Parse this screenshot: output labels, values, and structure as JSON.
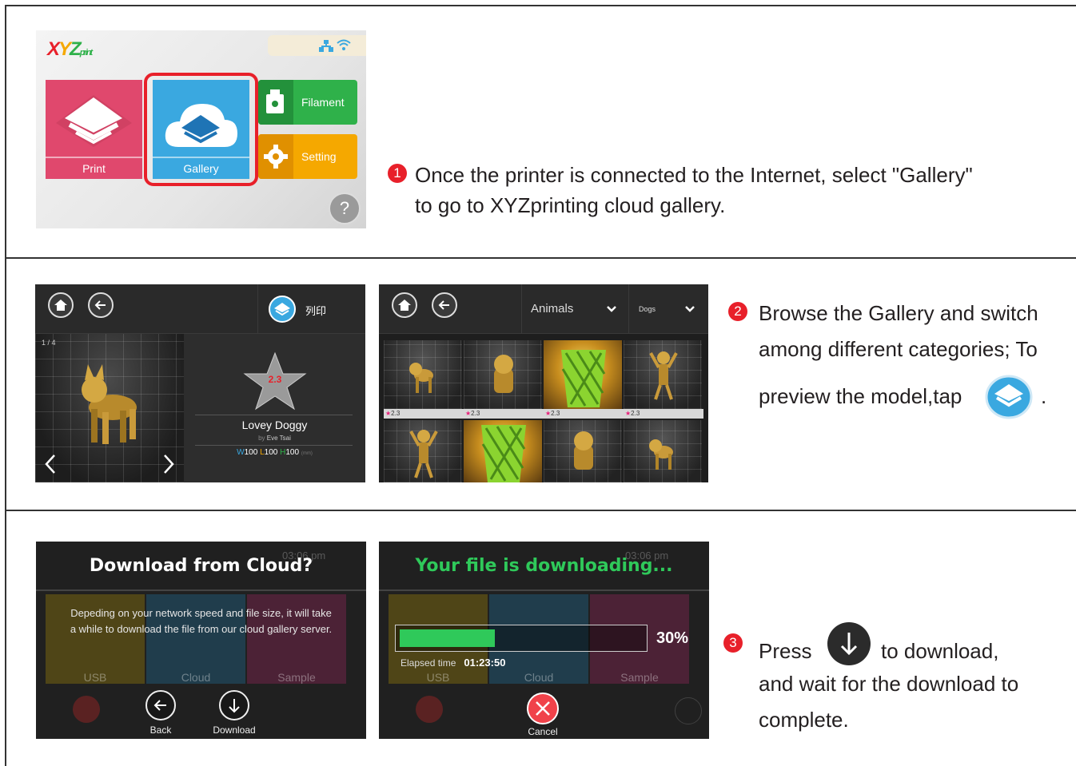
{
  "steps": [
    {
      "number": "1",
      "text_line1": "Once the printer is connected to the Internet, select \"Gallery\"",
      "text_line2": "to go to XYZprinting cloud gallery."
    },
    {
      "number": "2",
      "text_line1": "Browse the Gallery and switch",
      "text_line2": "among different categories; To",
      "text_line3": "preview the model,tap",
      "text_line3_end": "."
    },
    {
      "number": "3",
      "text_press": "Press",
      "text_after": "to download,",
      "text_line2": "and wait for the download to",
      "text_line3": "complete."
    }
  ],
  "home_screen": {
    "logo": "XYZprint",
    "status_icons": [
      "network-icon",
      "wifi-icon"
    ],
    "tiles": {
      "print": "Print",
      "gallery": "Gallery",
      "filament": "Filament",
      "setting": "Setting"
    },
    "help": "?",
    "colors": {
      "print": "#e0486d",
      "gallery": "#3aa8e0",
      "filament": "#2fb14a",
      "setting": "#f5a800",
      "highlight": "#e8202a"
    }
  },
  "gallery_detail": {
    "print_label": "列印",
    "page_indicator": "1 / 4",
    "rating": "2.3",
    "model_name": "Lovey Doggy",
    "author_prefix": "by",
    "author": "Eve Tsai",
    "dims": {
      "w_label": "W",
      "w": "100",
      "l_label": "L",
      "l": "100",
      "h_label": "H",
      "h": "100",
      "unit": "(mm)"
    }
  },
  "gallery_list": {
    "category": "Animals",
    "subcategory": "Dogs",
    "ratings": [
      "2.3",
      "2.3",
      "2.3",
      "2.3"
    ]
  },
  "download_dialog": {
    "title": "Download from Cloud?",
    "message_line1": "Depeding on your network speed and file size, it will take",
    "message_line2": "a while to download the file from our cloud gallery server.",
    "back_label": "Back",
    "download_label": "Download",
    "bg_time": "03:06 pm",
    "bg_tiles": [
      "USB",
      "Cloud",
      "Sample"
    ]
  },
  "downloading": {
    "title": "Your file is downloading...",
    "progress_percent": 30,
    "progress_label": "30%",
    "elapsed_label": "Elapsed time",
    "elapsed_value": "01:23:50",
    "cancel_label": "Cancel",
    "bg_time": "03:06 pm",
    "bg_tiles": [
      "USB",
      "Cloud",
      "Sample"
    ]
  }
}
